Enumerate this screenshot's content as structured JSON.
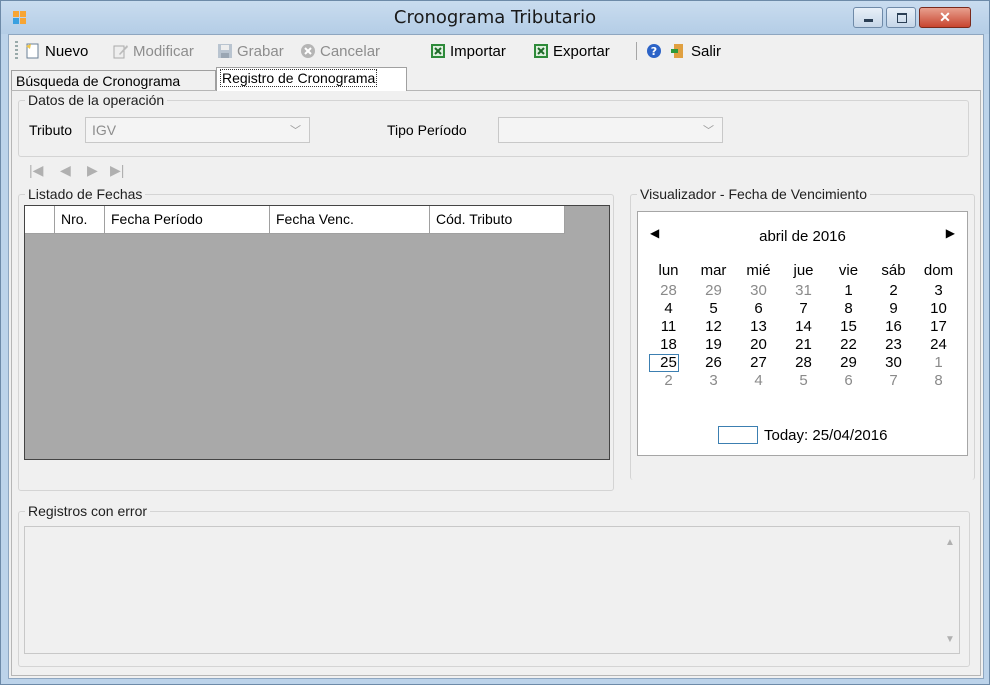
{
  "window": {
    "title": "Cronograma Tributario"
  },
  "toolbar": {
    "nuevo": "Nuevo",
    "modificar": "Modificar",
    "grabar": "Grabar",
    "cancelar": "Cancelar",
    "importar": "Importar",
    "exportar": "Exportar",
    "salir": "Salir"
  },
  "tabs": [
    "Búsqueda de Cronograma",
    "Registro de Cronograma"
  ],
  "operation": {
    "legend": "Datos de la operación",
    "tributo_label": "Tributo",
    "tributo_value": "IGV",
    "tipo_label": "Tipo Período",
    "tipo_value": ""
  },
  "fechas": {
    "legend": "Listado de Fechas",
    "columns": [
      "",
      "Nro.",
      "Fecha Período",
      "Fecha Venc.",
      "Cód. Tributo"
    ]
  },
  "visualizador": {
    "legend": "Visualizador - Fecha de Vencimiento",
    "month": "abril de 2016",
    "weekdays": [
      "lun",
      "mar",
      "mié",
      "jue",
      "vie",
      "sáb",
      "dom"
    ],
    "weeks": [
      [
        "28",
        "29",
        "30",
        "31",
        "1",
        "2",
        "3"
      ],
      [
        "4",
        "5",
        "6",
        "7",
        "8",
        "9",
        "10"
      ],
      [
        "11",
        "12",
        "13",
        "14",
        "15",
        "16",
        "17"
      ],
      [
        "18",
        "19",
        "20",
        "21",
        "22",
        "23",
        "24"
      ],
      [
        "25",
        "26",
        "27",
        "28",
        "29",
        "30",
        "1"
      ],
      [
        "2",
        "3",
        "4",
        "5",
        "6",
        "7",
        "8"
      ]
    ],
    "today": "Today: 25/04/2016"
  },
  "errores": {
    "legend": "Registros con error"
  }
}
